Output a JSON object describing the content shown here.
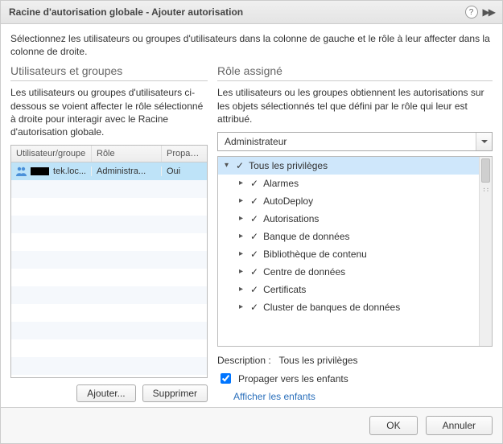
{
  "title": "Racine d'autorisation globale - Ajouter autorisation",
  "intro": "Sélectionnez les utilisateurs ou groupes d'utilisateurs dans la colonne de gauche et le rôle à leur affecter dans la colonne de droite.",
  "left": {
    "heading": "Utilisateurs et groupes",
    "desc": "Les utilisateurs ou groupes d'utilisateurs ci-dessous se voient affecter le rôle sélectionné à droite pour interagir avec le Racine d'autorisation globale.",
    "columns": {
      "c1": "Utilisateur/groupe",
      "c2": "Rôle",
      "c3": "Propager"
    },
    "rows": [
      {
        "user_suffix": "tek.loc...",
        "role": "Administra...",
        "propagate": "Oui",
        "selected": true
      }
    ],
    "add_label": "Ajouter...",
    "remove_label": "Supprimer"
  },
  "right": {
    "heading": "Rôle assigné",
    "desc": "Les utilisateurs ou les groupes obtiennent les autorisations sur les objets sélectionnés tel que défini par le rôle qui leur est attribué.",
    "role_selected": "Administrateur",
    "tree": [
      {
        "label": "Tous les privilèges",
        "level": 0,
        "expanded": true,
        "checked": true,
        "selected": true
      },
      {
        "label": "Alarmes",
        "level": 1,
        "expanded": false,
        "checked": true
      },
      {
        "label": "AutoDeploy",
        "level": 1,
        "expanded": false,
        "checked": true
      },
      {
        "label": "Autorisations",
        "level": 1,
        "expanded": false,
        "checked": true
      },
      {
        "label": "Banque de données",
        "level": 1,
        "expanded": false,
        "checked": true
      },
      {
        "label": "Bibliothèque de contenu",
        "level": 1,
        "expanded": false,
        "checked": true
      },
      {
        "label": "Centre de données",
        "level": 1,
        "expanded": false,
        "checked": true
      },
      {
        "label": "Certificats",
        "level": 1,
        "expanded": false,
        "checked": true
      },
      {
        "label": "Cluster de banques de données",
        "level": 1,
        "expanded": false,
        "checked": true
      }
    ],
    "description_label": "Description :",
    "description_value": "Tous les privilèges",
    "propagate_label": "Propager vers les enfants",
    "propagate_checked": true,
    "show_children": "Afficher les enfants"
  },
  "footer": {
    "ok": "OK",
    "cancel": "Annuler"
  }
}
